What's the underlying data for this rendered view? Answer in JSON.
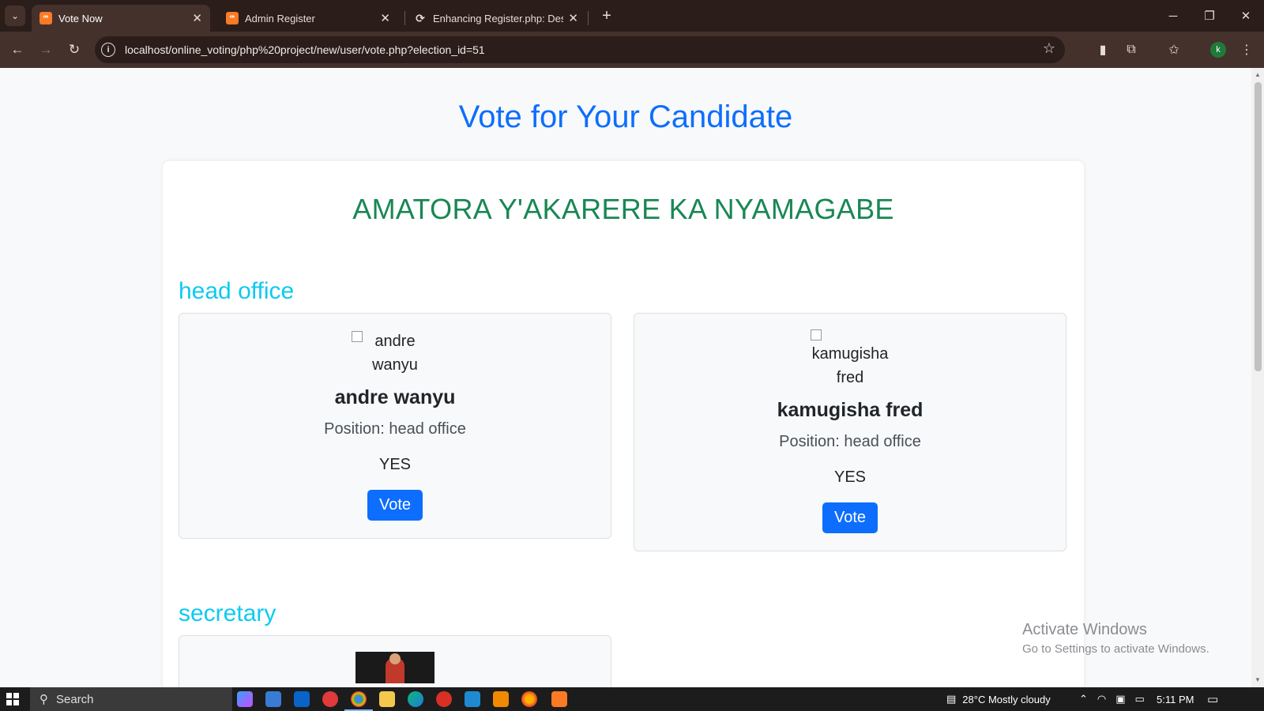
{
  "browser": {
    "tabs": [
      {
        "label": "Vote Now",
        "icon": "xampp-icon",
        "active": true
      },
      {
        "label": "Admin Register",
        "icon": "xampp-icon",
        "active": false
      },
      {
        "label": "Enhancing Register.php: Design",
        "icon": "ai-icon",
        "active": false
      }
    ],
    "new_tab_label": "+",
    "url": "localhost/online_voting/php%20project/new/user/vote.php?election_id=51",
    "profile_initial": "k"
  },
  "page": {
    "title": "Vote for Your Candidate",
    "election_name": "AMATORA Y'AKARERE KA NYAMAGABE",
    "positions": [
      {
        "name": "head office",
        "candidates": [
          {
            "img_alt": "andre wanyu",
            "name": "andre wanyu",
            "position_text": "Position: head office",
            "answer": "YES",
            "vote_label": "Vote"
          },
          {
            "img_alt": "kamugisha fred",
            "name": "kamugisha fred",
            "position_text": "Position: head office",
            "answer": "YES",
            "vote_label": "Vote"
          }
        ]
      },
      {
        "name": "secretary",
        "candidates": []
      }
    ]
  },
  "watermark": {
    "line1": "Activate Windows",
    "line2": "Go to Settings to activate Windows."
  },
  "taskbar": {
    "search_label": "Search",
    "weather": "28°C  Mostly cloudy",
    "time": "5:11 PM"
  },
  "colors": {
    "title": "#0d6efd",
    "election": "#198754",
    "position": "#0dcaf0",
    "button": "#0d6efd"
  }
}
